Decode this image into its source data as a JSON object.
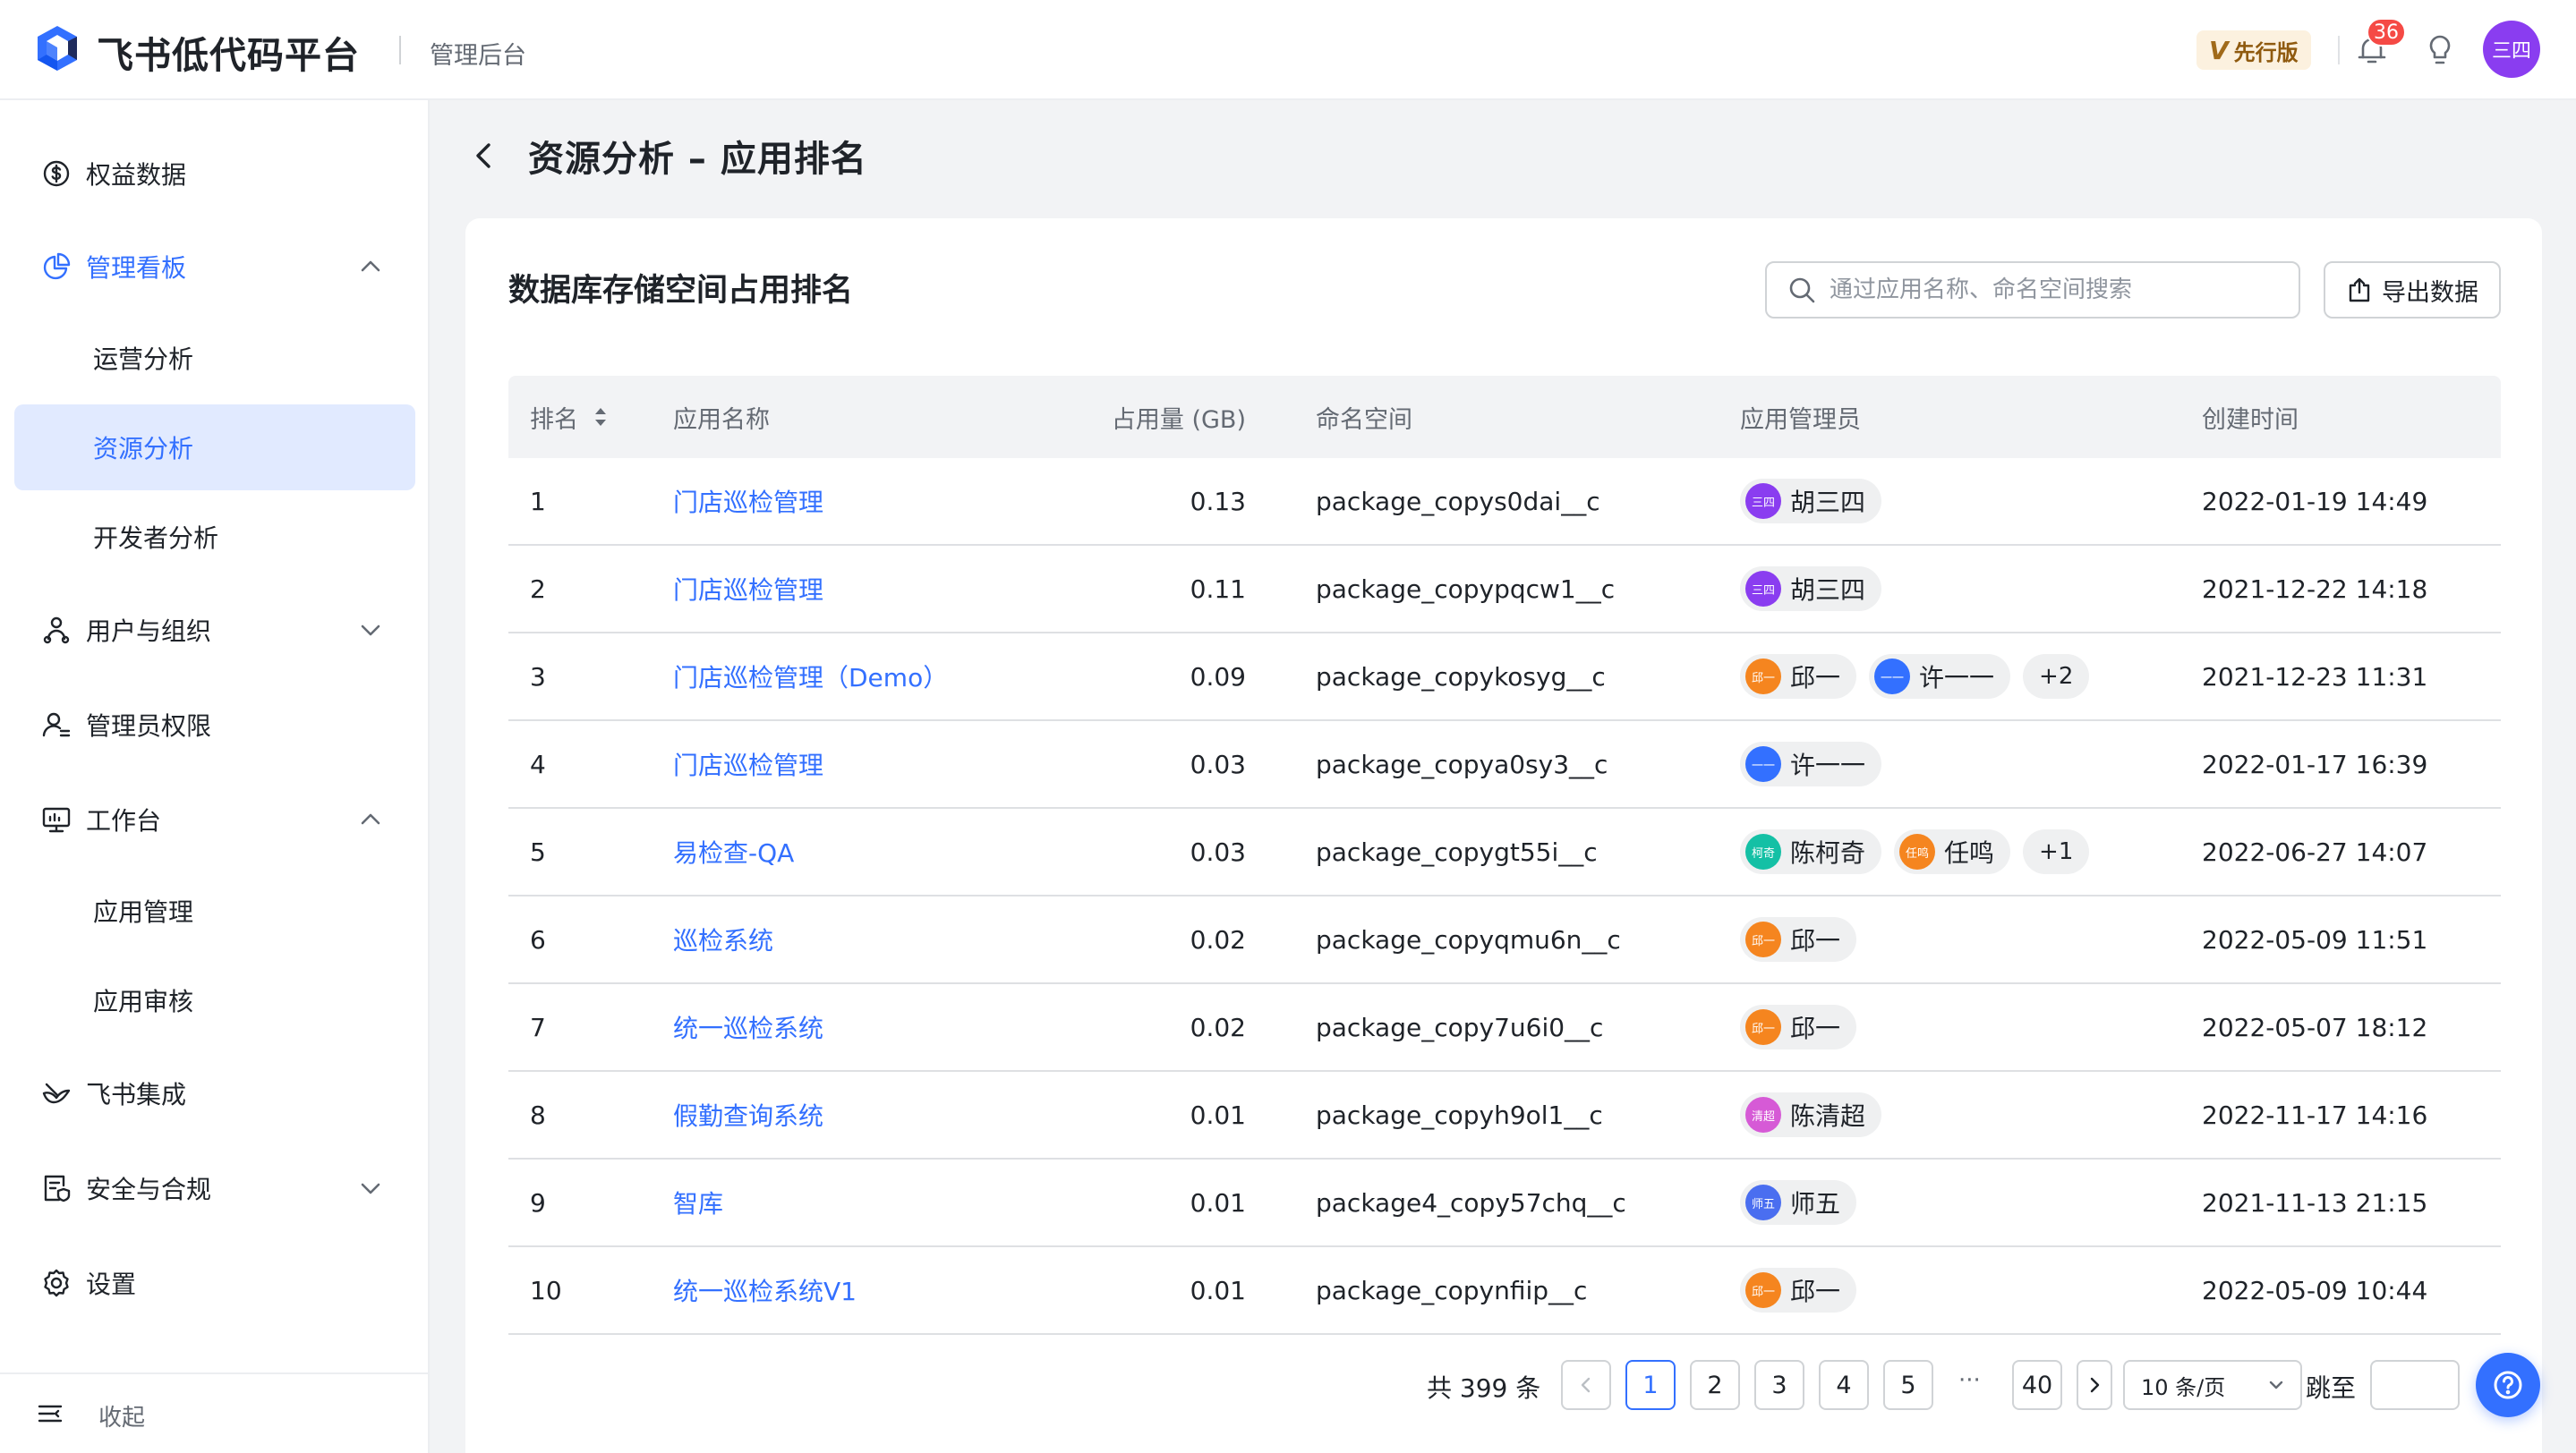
{
  "header": {
    "brand": "飞书低代码平台",
    "subtitle": "管理后台",
    "preview_badge": "先行版",
    "preview_badge_icon": "V",
    "notification_count": "36",
    "user_avatar": "三四"
  },
  "sidebar": {
    "items": [
      {
        "label": "权益数据",
        "icon": "dollar-circle-icon"
      },
      {
        "label": "管理看板",
        "icon": "pie-chart-icon",
        "expanded": true
      },
      {
        "label": "运营分析"
      },
      {
        "label": "资源分析",
        "active": true
      },
      {
        "label": "开发者分析"
      },
      {
        "label": "用户与组织",
        "icon": "org-icon",
        "expanded": false
      },
      {
        "label": "管理员权限",
        "icon": "admin-user-icon"
      },
      {
        "label": "工作台",
        "icon": "monitor-icon",
        "expanded": true
      },
      {
        "label": "应用管理"
      },
      {
        "label": "应用审核"
      },
      {
        "label": "飞书集成",
        "icon": "feishu-icon"
      },
      {
        "label": "安全与合规",
        "icon": "security-doc-icon",
        "expanded": false
      },
      {
        "label": "设置",
        "icon": "gear-icon"
      }
    ],
    "collapse_label": "收起"
  },
  "page": {
    "title": "资源分析 – 应用排名"
  },
  "card": {
    "title": "数据库存储空间占用排名",
    "search_placeholder": "通过应用名称、命名空间搜索",
    "export_label": "导出数据"
  },
  "table": {
    "columns": [
      "排名",
      "应用名称",
      "占用量 (GB)",
      "命名空间",
      "应用管理员",
      "创建时间"
    ],
    "rows": [
      {
        "rank": "1",
        "name": "门店巡检管理",
        "usage": "0.13",
        "namespace": "package_copys0dai__c",
        "admins": [
          {
            "name": "胡三四",
            "av": "三四",
            "color": "#8a3df0"
          }
        ],
        "more": "",
        "created": "2022-01-19 14:49"
      },
      {
        "rank": "2",
        "name": "门店巡检管理",
        "usage": "0.11",
        "namespace": "package_copypqcw1__c",
        "admins": [
          {
            "name": "胡三四",
            "av": "三四",
            "color": "#8a3df0"
          }
        ],
        "more": "",
        "created": "2021-12-22 14:18"
      },
      {
        "rank": "3",
        "name": "门店巡检管理（Demo）",
        "usage": "0.09",
        "namespace": "package_copykosyg__c",
        "admins": [
          {
            "name": "邱一",
            "av": "邱一",
            "color": "#f5851f"
          },
          {
            "name": "许一一",
            "av": "一一",
            "color": "#3370ff"
          }
        ],
        "more": "+2",
        "created": "2021-12-23 11:31"
      },
      {
        "rank": "4",
        "name": "门店巡检管理",
        "usage": "0.03",
        "namespace": "package_copya0sy3__c",
        "admins": [
          {
            "name": "许一一",
            "av": "一一",
            "color": "#3370ff"
          }
        ],
        "more": "",
        "created": "2022-01-17 16:39"
      },
      {
        "rank": "5",
        "name": "易检查-QA",
        "usage": "0.03",
        "namespace": "package_copygt55i__c",
        "admins": [
          {
            "name": "陈柯奇",
            "av": "柯奇",
            "color": "#14c0a5"
          },
          {
            "name": "任鸣",
            "av": "任鸣",
            "color": "#f5851f"
          }
        ],
        "more": "+1",
        "created": "2022-06-27 14:07"
      },
      {
        "rank": "6",
        "name": "巡检系统",
        "usage": "0.02",
        "namespace": "package_copyqmu6n__c",
        "admins": [
          {
            "name": "邱一",
            "av": "邱一",
            "color": "#f5851f"
          }
        ],
        "more": "",
        "created": "2022-05-09 11:51"
      },
      {
        "rank": "7",
        "name": "统一巡检系统",
        "usage": "0.02",
        "namespace": "package_copy7u6i0__c",
        "admins": [
          {
            "name": "邱一",
            "av": "邱一",
            "color": "#f5851f"
          }
        ],
        "more": "",
        "created": "2022-05-07 18:12"
      },
      {
        "rank": "8",
        "name": "假勤查询系统",
        "usage": "0.01",
        "namespace": "package_copyh9ol1__c",
        "admins": [
          {
            "name": "陈清超",
            "av": "清超",
            "color": "#d65ad6"
          }
        ],
        "more": "",
        "created": "2022-11-17 14:16"
      },
      {
        "rank": "9",
        "name": "智库",
        "usage": "0.01",
        "namespace": "package4_copy57chq__c",
        "admins": [
          {
            "name": "师五",
            "av": "师五",
            "color": "#4a6ef0"
          }
        ],
        "more": "",
        "created": "2021-11-13 21:15"
      },
      {
        "rank": "10",
        "name": "统一巡检系统V1",
        "usage": "0.01",
        "namespace": "package_copynfiip__c",
        "admins": [
          {
            "name": "邱一",
            "av": "邱一",
            "color": "#f5851f"
          }
        ],
        "more": "",
        "created": "2022-05-09 10:44"
      }
    ]
  },
  "pagination": {
    "total_label": "共 399 条",
    "pages": [
      "1",
      "2",
      "3",
      "4",
      "5"
    ],
    "ellipsis": "···",
    "last_page": "40",
    "current_page": "1",
    "page_size": "10 条/页",
    "jump_label": "跳至"
  },
  "colors": {
    "accent": "#3370ff",
    "active_bg": "#e1eaff",
    "badge_red": "#f54a45"
  }
}
